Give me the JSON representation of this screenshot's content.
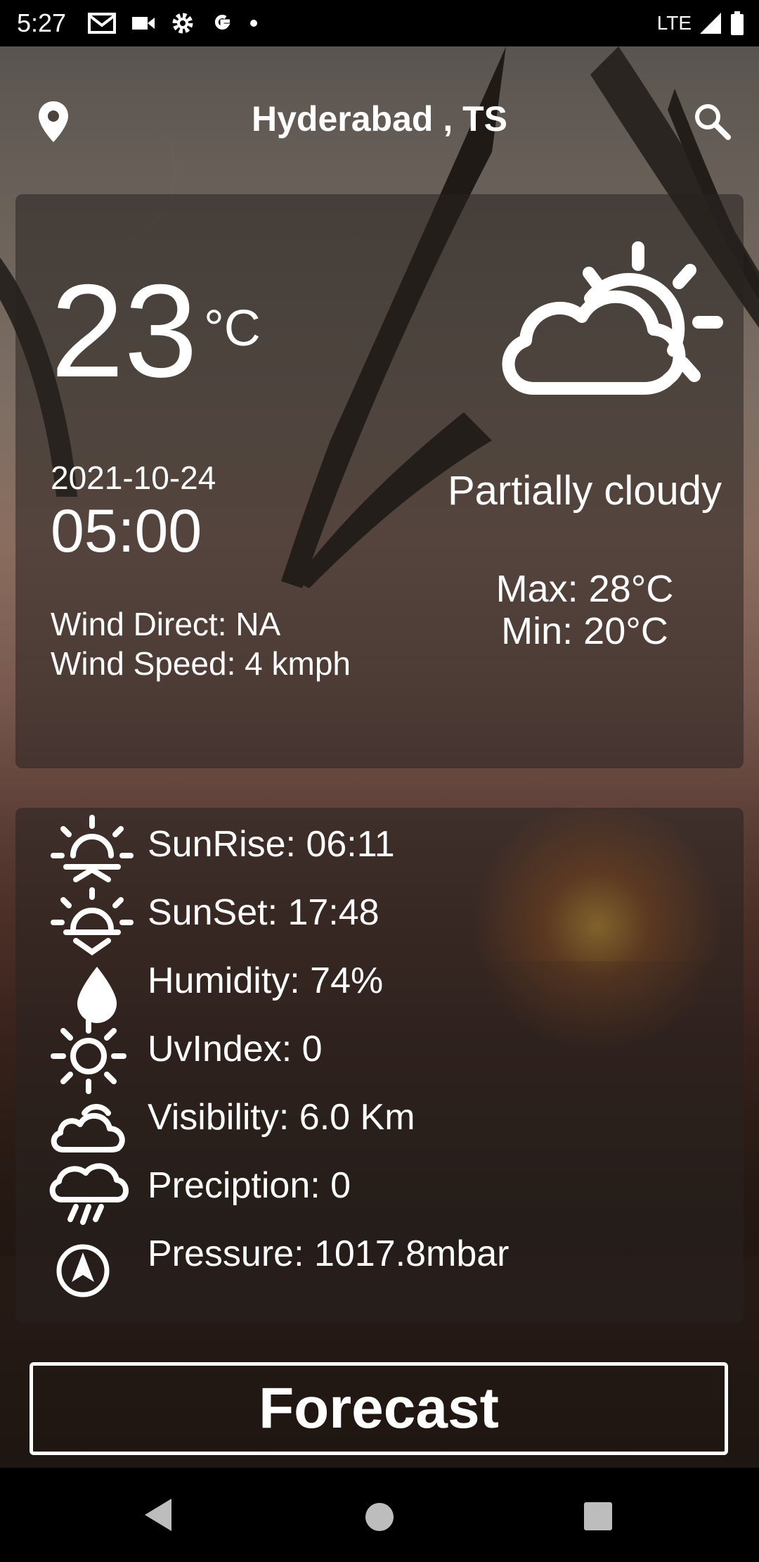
{
  "status_bar": {
    "time": "5:27",
    "network": "LTE",
    "icons": [
      "gmail-icon",
      "video-icon",
      "settings-icon",
      "google-icon",
      "dot-icon",
      "signal-icon",
      "battery-icon"
    ]
  },
  "header": {
    "location_icon": "location-pin-icon",
    "city": "Hyderabad ,  TS",
    "search_icon": "search-icon"
  },
  "current": {
    "temperature": "23",
    "unit": "°C",
    "date": "2021-10-24",
    "time": "05:00",
    "wind_direction": "Wind Direct: NA",
    "wind_speed": "Wind Speed: 4 kmph",
    "condition_icon": "partly-cloudy-icon",
    "condition": "Partially cloudy",
    "max": "Max: 28°C",
    "min": "Min: 20°C"
  },
  "details": [
    {
      "icon": "sunrise-icon",
      "text": "SunRise: 06:11"
    },
    {
      "icon": "sunset-icon",
      "text": "SunSet: 17:48"
    },
    {
      "icon": "humidity-icon",
      "text": "Humidity: 74%"
    },
    {
      "icon": "uv-index-icon",
      "text": "UvIndex: 0"
    },
    {
      "icon": "visibility-cloud-icon",
      "text": "Visibility: 6.0 Km"
    },
    {
      "icon": "rain-icon",
      "text": "Preciption: 0"
    },
    {
      "icon": "pressure-compass-icon",
      "text": "Pressure: 1017.8mbar"
    }
  ],
  "forecast_button": "Forecast",
  "nav": {
    "back_icon": "back-triangle-icon",
    "home_icon": "home-circle-icon",
    "recents_icon": "recents-square-icon"
  }
}
